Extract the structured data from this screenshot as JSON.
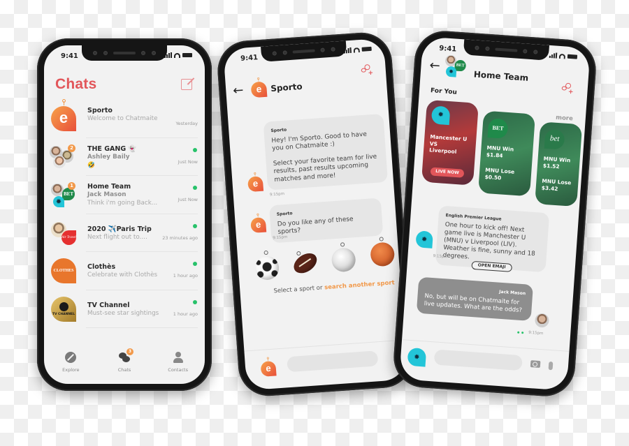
{
  "status_bar": {
    "time": "9:41"
  },
  "chats_screen": {
    "title": "Chats",
    "compose_icon": "compose-icon",
    "chats": [
      {
        "name": "Sporto",
        "line1": "Welcome to Chatmaite",
        "line2": "",
        "time": "Yesterday",
        "online": false,
        "badge": ""
      },
      {
        "name": "THE GANG 👻",
        "line1": "Ashley Baily",
        "line2": "🤣",
        "time": "Just Now",
        "online": true,
        "badge": "2"
      },
      {
        "name": "Home Team",
        "line1": "Jack Mason",
        "line2": "Think i'm going Back...",
        "time": "Just Now",
        "online": true,
        "badge": "1"
      },
      {
        "name": "2020 ✈️Paris Trip",
        "line1": "Next flight out to....",
        "line2": "",
        "time": "23 minutes ago",
        "online": true,
        "badge": ""
      },
      {
        "name": "Clothès",
        "line1": "Celebrate with Clothès",
        "line2": "",
        "time": "1 hour ago",
        "online": true,
        "badge": ""
      },
      {
        "name": "TV Channel",
        "line1": "Must-see star sightings",
        "line2": "",
        "time": "1 hour ago",
        "online": true,
        "badge": ""
      }
    ],
    "avatar_labels": {
      "bet": "BET",
      "air_travel": "Air Travel",
      "clothes": "CLOTHES",
      "tv": "TV CHANNEL"
    },
    "tabs": [
      {
        "label": "Explore",
        "icon": "compass-icon"
      },
      {
        "label": "Chats",
        "icon": "chat-bubbles-icon",
        "badge": "3"
      },
      {
        "label": "Contacts",
        "icon": "person-icon"
      }
    ]
  },
  "sporto_screen": {
    "title": "Sporto",
    "messages": [
      {
        "sender": "Sporto",
        "text1": "Hey! I'm Sporto. Good to have you on Chatmaite :)",
        "text2": "Select your favorite team for live results, past results upcoming matches and more!",
        "time": "9:15pm"
      },
      {
        "sender": "Sporto",
        "text1": "Do you like any of these sports?",
        "time": "9:15pm"
      }
    ],
    "sports": [
      "Soccer",
      "American Football",
      "Volleyball",
      "Basketball"
    ],
    "select_prefix": "Select a sport or ",
    "select_link": "search another sport"
  },
  "home_team_screen": {
    "title": "Home Team",
    "section_title": "For You",
    "more_label": "more",
    "cards": [
      {
        "line1": "Mancester U",
        "line2": "VS",
        "line3": "Liverpool",
        "button": "LIVE NOW"
      },
      {
        "logo": "BET",
        "win": "MNU Win",
        "win_odds": "$1.84",
        "lose": "MNU Lose",
        "lose_odds": "$0.50"
      },
      {
        "logo": "bet",
        "win": "MNU Win",
        "win_odds": "$1.52",
        "lose": "MNU Lose",
        "lose_odds": "$3.42"
      }
    ],
    "messages": [
      {
        "sender": "English Premier League",
        "text": "One hour to kick off! Next game live is Manchester U (MNU) v Liverpool (LIV). Weather is fine, sunny and 18 degrees.",
        "time": "9:15pm",
        "action": "OPEN EMAJI"
      },
      {
        "sender": "Jack Mason",
        "text": "No, but will be on Chatmaite for live updates. What are the odds?",
        "time": "9:15pm"
      }
    ]
  },
  "colors": {
    "accent_red": "#e2565a",
    "accent_orange": "#f2994a",
    "online_green": "#27c26a",
    "tiger_cyan": "#23c5d8",
    "bet_green": "#1f8a4a"
  }
}
